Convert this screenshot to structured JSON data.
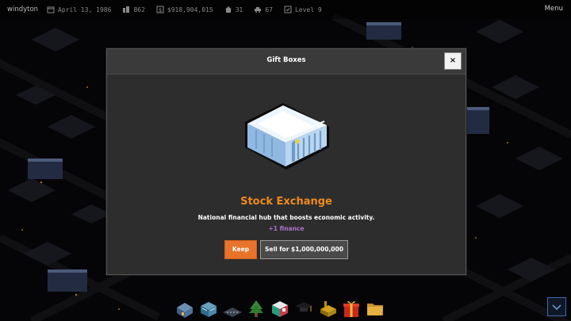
{
  "hud": {
    "city_name": "windyton",
    "date": "April 13, 1986",
    "buildings": "862",
    "money": "$918,904,015",
    "population": "31",
    "vehicles": "67",
    "level": "Level 9",
    "menu_label": "Menu"
  },
  "modal": {
    "title": "Gift Boxes",
    "close_label": "×",
    "item_name": "Stock Exchange",
    "item_description": "National financial hub that boosts economic activity.",
    "item_bonus": "+1 finance",
    "keep_label": "Keep",
    "sell_label": "Sell for $1,000,000,000"
  },
  "toolbar": {
    "tools": [
      {
        "icon": "house-icon"
      },
      {
        "icon": "shop-icon"
      },
      {
        "icon": "road-icon"
      },
      {
        "icon": "tree-icon"
      },
      {
        "icon": "hospital-icon"
      },
      {
        "icon": "school-icon"
      },
      {
        "icon": "construction-icon"
      },
      {
        "icon": "gift-icon"
      },
      {
        "icon": "folder-icon"
      }
    ]
  },
  "colors": {
    "accent": "#e8732a",
    "title_orange": "#f08a1c",
    "bonus_purple": "#b070d0",
    "modal_bg": "#2d2d2d"
  }
}
